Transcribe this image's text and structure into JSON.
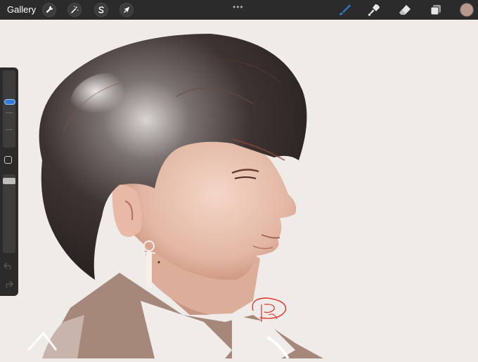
{
  "topbar": {
    "gallery_label": "Gallery",
    "left_tools": [
      {
        "name": "actions",
        "icon": "wrench-icon"
      },
      {
        "name": "adjustments",
        "icon": "magic-wand-icon"
      },
      {
        "name": "selection",
        "icon": "selection-s-icon"
      },
      {
        "name": "transform",
        "icon": "arrow-cursor-icon"
      }
    ],
    "more_menu": "•••",
    "right_tools": [
      {
        "name": "brush",
        "icon": "brush-icon",
        "active": true
      },
      {
        "name": "smudge",
        "icon": "smudge-icon"
      },
      {
        "name": "eraser",
        "icon": "eraser-icon"
      },
      {
        "name": "layers",
        "icon": "layers-icon"
      }
    ],
    "current_color": "#b8998a",
    "active_color": "#2e7dd8"
  },
  "sidebar": {
    "brush_size_level": 0.6,
    "opacity_level": 0.95,
    "undo_icon": "undo-icon",
    "redo_icon": "redo-icon"
  }
}
